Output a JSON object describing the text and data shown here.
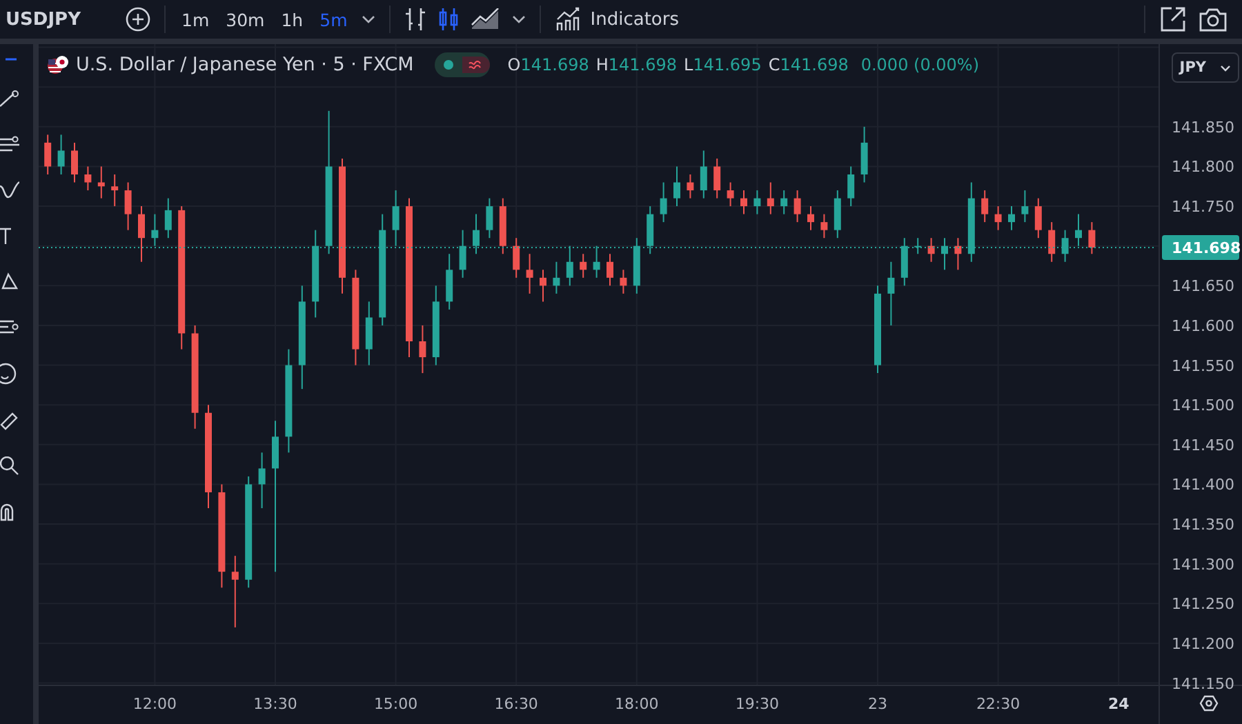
{
  "toolbar": {
    "symbol": "USDJPY",
    "intervals": [
      {
        "label": "1m",
        "selected": false
      },
      {
        "label": "30m",
        "selected": false
      },
      {
        "label": "1h",
        "selected": false
      },
      {
        "label": "5m",
        "selected": true
      }
    ],
    "indicators_label": "Indicators"
  },
  "legend": {
    "title": "U.S. Dollar / Japanese Yen · 5 · FXCM",
    "ohlc": [
      {
        "label": "O",
        "value": "141.698"
      },
      {
        "label": "H",
        "value": "141.698"
      },
      {
        "label": "L",
        "value": "141.695"
      },
      {
        "label": "C",
        "value": "141.698"
      }
    ],
    "change": "0.000 (0.00%)"
  },
  "currency": "JPY",
  "time_axis": [
    {
      "label": "12:00",
      "bold": false
    },
    {
      "label": "13:30",
      "bold": false
    },
    {
      "label": "15:00",
      "bold": false
    },
    {
      "label": "16:30",
      "bold": false
    },
    {
      "label": "18:00",
      "bold": false
    },
    {
      "label": "19:30",
      "bold": false
    },
    {
      "label": "23",
      "bold": false
    },
    {
      "label": "22:30",
      "bold": false
    },
    {
      "label": "24",
      "bold": true
    }
  ],
  "chart_data": {
    "type": "candlestick",
    "ylim": [
      141.147,
      141.954
    ],
    "grid": true,
    "ref_lines": [
      {
        "value": 141.698,
        "axis": "y",
        "label": "141.698",
        "color": "#26a69a"
      }
    ],
    "ohlc": [
      [
        141.83,
        141.84,
        141.79,
        141.8
      ],
      [
        141.8,
        141.84,
        141.79,
        141.82
      ],
      [
        141.82,
        141.83,
        141.78,
        141.79
      ],
      [
        141.79,
        141.8,
        141.77,
        141.78
      ],
      [
        141.78,
        141.8,
        141.76,
        141.775
      ],
      [
        141.775,
        141.79,
        141.75,
        141.77
      ],
      [
        141.77,
        141.78,
        141.72,
        141.74
      ],
      [
        141.74,
        141.75,
        141.68,
        141.71
      ],
      [
        141.71,
        141.74,
        141.7,
        141.72
      ],
      [
        141.72,
        141.76,
        141.71,
        141.745
      ],
      [
        141.745,
        141.75,
        141.57,
        141.59
      ],
      [
        141.59,
        141.6,
        141.47,
        141.49
      ],
      [
        141.49,
        141.5,
        141.37,
        141.39
      ],
      [
        141.39,
        141.4,
        141.27,
        141.29
      ],
      [
        141.29,
        141.31,
        141.22,
        141.28
      ],
      [
        141.28,
        141.41,
        141.27,
        141.4
      ],
      [
        141.4,
        141.44,
        141.37,
        141.42
      ],
      [
        141.42,
        141.48,
        141.29,
        141.46
      ],
      [
        141.46,
        141.57,
        141.44,
        141.55
      ],
      [
        141.55,
        141.65,
        141.52,
        141.63
      ],
      [
        141.63,
        141.72,
        141.61,
        141.7
      ],
      [
        141.7,
        141.87,
        141.69,
        141.8
      ],
      [
        141.8,
        141.81,
        141.64,
        141.66
      ],
      [
        141.66,
        141.67,
        141.55,
        141.57
      ],
      [
        141.57,
        141.63,
        141.55,
        141.61
      ],
      [
        141.61,
        141.74,
        141.6,
        141.72
      ],
      [
        141.72,
        141.77,
        141.7,
        141.75
      ],
      [
        141.75,
        141.76,
        141.56,
        141.58
      ],
      [
        141.58,
        141.6,
        141.54,
        141.56
      ],
      [
        141.56,
        141.65,
        141.55,
        141.63
      ],
      [
        141.63,
        141.69,
        141.62,
        141.67
      ],
      [
        141.67,
        141.72,
        141.66,
        141.7
      ],
      [
        141.7,
        141.74,
        141.69,
        141.72
      ],
      [
        141.72,
        141.76,
        141.71,
        141.75
      ],
      [
        141.75,
        141.76,
        141.69,
        141.7
      ],
      [
        141.7,
        141.71,
        141.66,
        141.67
      ],
      [
        141.67,
        141.69,
        141.64,
        141.66
      ],
      [
        141.66,
        141.67,
        141.63,
        141.65
      ],
      [
        141.65,
        141.68,
        141.64,
        141.66
      ],
      [
        141.66,
        141.7,
        141.65,
        141.68
      ],
      [
        141.68,
        141.69,
        141.66,
        141.67
      ],
      [
        141.67,
        141.7,
        141.66,
        141.68
      ],
      [
        141.68,
        141.69,
        141.65,
        141.66
      ],
      [
        141.66,
        141.67,
        141.64,
        141.65
      ],
      [
        141.65,
        141.71,
        141.64,
        141.7
      ],
      [
        141.7,
        141.75,
        141.69,
        141.74
      ],
      [
        141.74,
        141.78,
        141.73,
        141.76
      ],
      [
        141.76,
        141.8,
        141.75,
        141.78
      ],
      [
        141.78,
        141.79,
        141.76,
        141.77
      ],
      [
        141.77,
        141.82,
        141.76,
        141.8
      ],
      [
        141.8,
        141.81,
        141.76,
        141.77
      ],
      [
        141.77,
        141.78,
        141.75,
        141.76
      ],
      [
        141.76,
        141.77,
        141.74,
        141.75
      ],
      [
        141.75,
        141.77,
        141.74,
        141.76
      ],
      [
        141.76,
        141.78,
        141.74,
        141.75
      ],
      [
        141.75,
        141.77,
        141.74,
        141.76
      ],
      [
        141.76,
        141.77,
        141.73,
        141.74
      ],
      [
        141.74,
        141.75,
        141.72,
        141.73
      ],
      [
        141.73,
        141.74,
        141.71,
        141.72
      ],
      [
        141.72,
        141.77,
        141.71,
        141.76
      ],
      [
        141.76,
        141.8,
        141.75,
        141.79
      ],
      [
        141.79,
        141.85,
        141.78,
        141.83
      ],
      [
        141.55,
        141.65,
        141.54,
        141.64
      ],
      [
        141.64,
        141.68,
        141.6,
        141.66
      ],
      [
        141.66,
        141.71,
        141.65,
        141.7
      ],
      [
        141.7,
        141.71,
        141.69,
        141.7
      ],
      [
        141.7,
        141.71,
        141.68,
        141.69
      ],
      [
        141.69,
        141.71,
        141.67,
        141.7
      ],
      [
        141.7,
        141.71,
        141.67,
        141.69
      ],
      [
        141.69,
        141.78,
        141.68,
        141.76
      ],
      [
        141.76,
        141.77,
        141.73,
        141.74
      ],
      [
        141.74,
        141.75,
        141.72,
        141.73
      ],
      [
        141.73,
        141.75,
        141.72,
        141.74
      ],
      [
        141.74,
        141.77,
        141.73,
        141.75
      ],
      [
        141.75,
        141.76,
        141.71,
        141.72
      ],
      [
        141.72,
        141.73,
        141.68,
        141.69
      ],
      [
        141.69,
        141.72,
        141.68,
        141.71
      ],
      [
        141.71,
        141.74,
        141.7,
        141.72
      ],
      [
        141.72,
        141.73,
        141.69,
        141.698
      ]
    ],
    "yticks": [
      {
        "value": 141.85,
        "label": "141.850"
      },
      {
        "value": 141.8,
        "label": "141.800"
      },
      {
        "value": 141.75,
        "label": "141.750"
      },
      {
        "value": 141.65,
        "label": "141.650"
      },
      {
        "value": 141.6,
        "label": "141.600"
      },
      {
        "value": 141.55,
        "label": "141.550"
      },
      {
        "value": 141.5,
        "label": "141.500"
      },
      {
        "value": 141.45,
        "label": "141.450"
      },
      {
        "value": 141.4,
        "label": "141.400"
      },
      {
        "value": 141.35,
        "label": "141.350"
      },
      {
        "value": 141.3,
        "label": "141.300"
      },
      {
        "value": 141.25,
        "label": "141.250"
      },
      {
        "value": 141.2,
        "label": "141.200"
      },
      {
        "value": 141.15,
        "label": "141.150"
      }
    ]
  }
}
